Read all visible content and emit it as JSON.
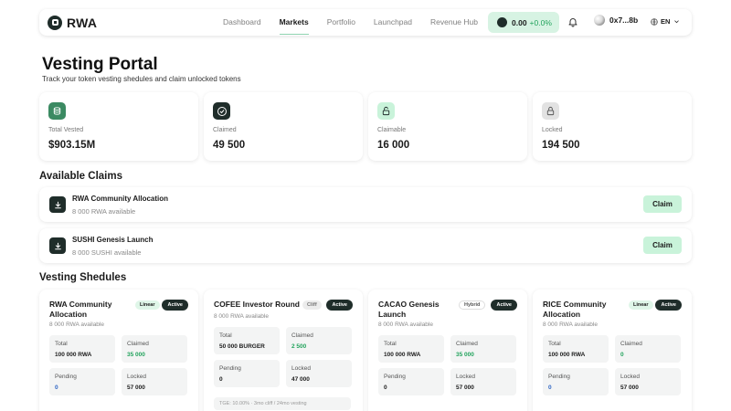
{
  "header": {
    "logo_text": "RWA",
    "nav": [
      "Dashboard",
      "Markets",
      "Portfolio",
      "Launchpad",
      "Revenue Hub"
    ],
    "active_nav": "Markets",
    "balance_value": "0.00",
    "balance_change": "+0.0%",
    "wallet_address": "0x7...8b",
    "language": "EN"
  },
  "page": {
    "title": "Vesting Portal",
    "subtitle": "Track your token vesting shedules and claim unlocked tokens"
  },
  "stats": [
    {
      "label": "Total Vested",
      "value": "$903.15M",
      "icon": "coin-stack-icon"
    },
    {
      "label": "Claimed",
      "value": "49 500",
      "icon": "check-circle-icon"
    },
    {
      "label": "Claimable",
      "value": "16 000",
      "icon": "unlock-icon"
    },
    {
      "label": "Locked",
      "value": "194 500",
      "icon": "lock-icon"
    }
  ],
  "claims": {
    "title": "Available Claims",
    "items": [
      {
        "name": "RWA Community Allocation",
        "available": "8 000 RWA available",
        "button": "Claim"
      },
      {
        "name": "SUSHI Genesis Launch",
        "available": "8 000 SUSHI available",
        "button": "Claim"
      }
    ]
  },
  "vesting": {
    "title": "Vesting Shedules",
    "cards": [
      {
        "name": "RWA Community Allocation",
        "type": "Linear",
        "status": "Active",
        "available": "8 000 RWA available",
        "total_label": "Total",
        "total": "100 000 RWA",
        "claimed_label": "Claimed",
        "claimed": "35 000",
        "pending_label": "Pending",
        "pending": "0",
        "locked_label": "Locked",
        "locked": "57 000"
      },
      {
        "name": "COFEE Investor Round",
        "type": "Cliff",
        "status": "Active",
        "available": "8 000 RWA available",
        "total_label": "Total",
        "total": "50 000 BURGER",
        "claimed_label": "Claimed",
        "claimed": "2 500",
        "pending_label": "Pending",
        "pending": "0",
        "locked_label": "Locked",
        "locked": "47 000",
        "note": "TGE: 10.00% · 3mo cliff / 24mo vesting"
      },
      {
        "name": "CACAO Genesis Launch",
        "type": "Hybrid",
        "status": "Active",
        "available": "8 000 RWA available",
        "total_label": "Total",
        "total": "100 000 RWA",
        "claimed_label": "Claimed",
        "claimed": "35 000",
        "pending_label": "Pending",
        "pending": "0",
        "locked_label": "Locked",
        "locked": "57 000"
      },
      {
        "name": "RICE Community Allocation",
        "type": "Linear",
        "status": "Active",
        "available": "8 000 RWA available",
        "total_label": "Total",
        "total": "100 000 RWA",
        "claimed_label": "Claimed",
        "claimed": "0",
        "pending_label": "Pending",
        "pending": "0",
        "locked_label": "Locked",
        "locked": "57 000"
      }
    ]
  },
  "colors": {
    "brand_dark": "#1f2d2a",
    "accent_green": "#c9f3da",
    "positive": "#22a35c",
    "pending_blue": "#3066c4"
  }
}
